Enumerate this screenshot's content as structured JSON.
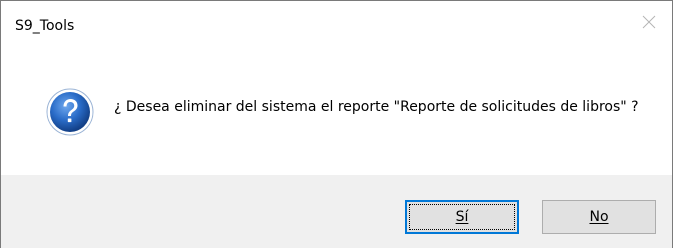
{
  "window": {
    "title": "S9_Tools",
    "close_icon": "close-icon"
  },
  "message": {
    "icon": "question-icon",
    "text": "¿ Desea eliminar del sistema el reporte \"Reporte de solicitudes de libros\" ?"
  },
  "buttons": {
    "yes_label": "Sí",
    "no_label": "No",
    "default": "yes"
  },
  "colors": {
    "focus_border": "#0078d7",
    "footer_bg": "#f0f0f0",
    "button_bg": "#e1e1e1",
    "icon_blue": "#1f5fb4"
  }
}
